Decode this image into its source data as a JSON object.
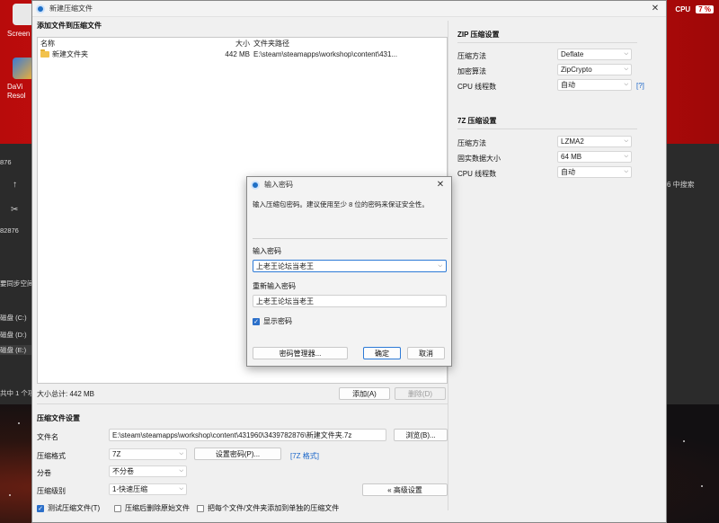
{
  "desktop": {
    "icon1_label": "Screen",
    "icon2_label": "DaVi Resol",
    "cpu_label": "CPU",
    "cpu_value": "7 %",
    "left_texts": [
      "876",
      "↑",
      "✂",
      "82876",
      "要同步空间",
      "磁盘 (C:)",
      "磁盘 (D:)",
      "磁盘 (E:)",
      "共中 1 个项"
    ],
    "right_search": "6 中搜索"
  },
  "window": {
    "title": "新建压缩文件",
    "add_section_title": "添加文件到压缩文件",
    "columns": {
      "name": "名称",
      "size": "大小",
      "path": "文件夹路径"
    },
    "files": [
      {
        "name": "新建文件夹",
        "size": "442 MB",
        "path": "E:\\steam\\steamapps\\workshop\\content\\431..."
      }
    ],
    "total_size": "大小总计: 442 MB",
    "add_button": "添加(A)",
    "delete_button": "删除(D)",
    "settings_title": "压缩文件设置",
    "filename_label": "文件名",
    "filename_value": "E:\\steam\\steamapps\\workshop\\content\\431960\\3439782876\\新建文件夹.7z",
    "browse_button": "浏览(B)...",
    "format_label": "压缩格式",
    "format_value": "7Z",
    "set_password_button": "设置密码(P)...",
    "format_hint": "[7Z 格式]",
    "split_label": "分卷",
    "split_value": "不分卷",
    "level_label": "压缩级别",
    "level_value": "1-快速压缩",
    "advanced_button": "« 高级设置",
    "test_checkbox": "测试压缩文件(T)",
    "test_checked": true,
    "delete_after_checkbox": "压缩后删除原始文件",
    "delete_after_checked": false,
    "separate_checkbox": "把每个文件/文件夹添加到单独的压缩文件",
    "separate_checked": false
  },
  "zip": {
    "title": "ZIP 压缩设置",
    "method_label": "压缩方法",
    "method_value": "Deflate",
    "enc_label": "加密算法",
    "enc_value": "ZipCrypto",
    "threads_label": "CPU 线程数",
    "threads_value": "自动",
    "help": "[?]"
  },
  "sevenz": {
    "title": "7Z 压缩设置",
    "method_label": "压缩方法",
    "method_value": "LZMA2",
    "solid_label": "固实数据大小",
    "solid_value": "64 MB",
    "threads_label": "CPU 线程数",
    "threads_value": "自动"
  },
  "dialog": {
    "title": "输入密码",
    "description": "输入压缩包密码。建议使用至少 8 位的密码来保证安全性。",
    "password_label": "输入密码",
    "password_value": "上老王论坛当老王",
    "confirm_label": "重新输入密码",
    "confirm_value": "上老王论坛当老王",
    "show_password": "显示密码",
    "show_password_checked": true,
    "manager_button": "密码管理器...",
    "ok_button": "确定",
    "cancel_button": "取消"
  }
}
